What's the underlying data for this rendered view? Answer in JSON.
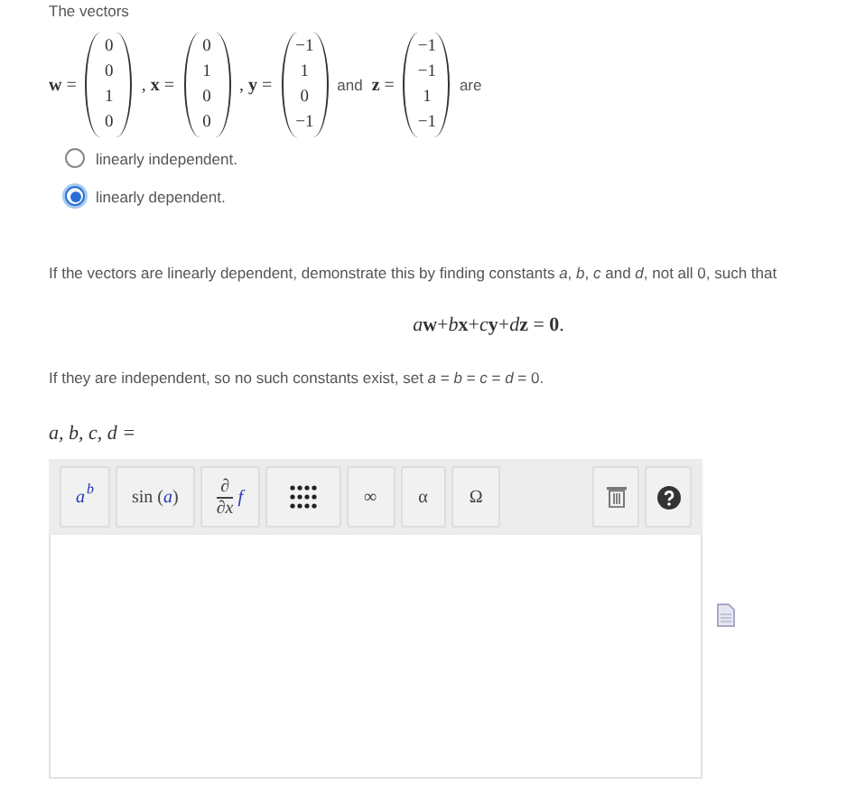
{
  "intro": "The vectors",
  "statement": [
    {
      "kind": "math",
      "text": "**w** ="
    },
    {
      "kind": "vector",
      "entries": [
        "0",
        "0",
        "1",
        "0"
      ]
    },
    {
      "kind": "math",
      "text": ", **x** ="
    },
    {
      "kind": "vector",
      "entries": [
        "0",
        "1",
        "0",
        "0"
      ]
    },
    {
      "kind": "math",
      "text": ", **y** ="
    },
    {
      "kind": "vector",
      "entries": [
        "−1",
        "1",
        "0",
        "−1"
      ]
    },
    {
      "kind": "text",
      "text": "and"
    },
    {
      "kind": "math",
      "text": "**z** ="
    },
    {
      "kind": "vector",
      "entries": [
        "−1",
        "−1",
        "1",
        "−1"
      ]
    },
    {
      "kind": "text",
      "text": "are"
    }
  ],
  "options": [
    {
      "label": "linearly independent.",
      "selected": false
    },
    {
      "label": "linearly dependent.",
      "selected": true
    }
  ],
  "instruction": "If the vectors are linearly dependent, demonstrate this by finding constants *a*, *b*, *c* and *d*, not all 0, such that",
  "equation": {
    "terms": [
      {
        "coef": "a",
        "vec": "w"
      },
      {
        "coef": "b",
        "vec": "x"
      },
      {
        "coef": "c",
        "vec": "y"
      },
      {
        "coef": "d",
        "vec": "z"
      }
    ],
    "plus": "+",
    "equals": "=",
    "rhs": "0",
    "end": "."
  },
  "note": "If they are independent, so no such constants exist, set *a* = *b* = *c* = *d* = 0.",
  "answer_label": "a, b, c, d =",
  "toolbar": [
    {
      "kind": "power",
      "base": "a",
      "exp": "b"
    },
    {
      "kind": "func",
      "name": "sin",
      "open": "(",
      "arg": "a",
      "close": ")"
    },
    {
      "kind": "deriv",
      "top": "∂",
      "bottom": "∂",
      "var": "x",
      "fn": "f"
    },
    {
      "kind": "matrix"
    },
    {
      "kind": "symbol",
      "text": "∞"
    },
    {
      "kind": "symbol",
      "text": "α"
    },
    {
      "kind": "symbol",
      "text": "Ω"
    }
  ],
  "toolbar_right": [
    {
      "kind": "trash"
    },
    {
      "kind": "help"
    }
  ]
}
